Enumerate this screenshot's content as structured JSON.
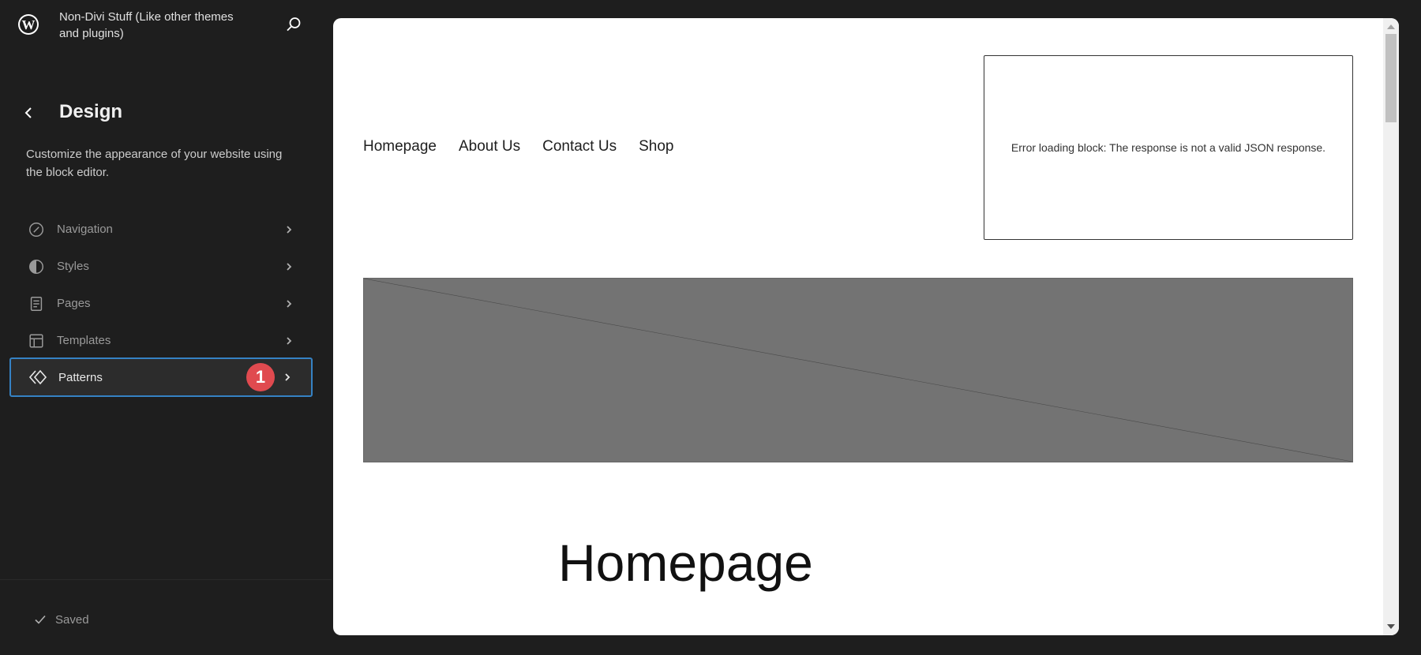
{
  "sidebar": {
    "site_title": "Non-Divi Stuff (Like other themes and plugins)",
    "section_title": "Design",
    "description": "Customize the appearance of your website using the block editor.",
    "items": [
      {
        "label": "Navigation",
        "icon": "navigation-icon"
      },
      {
        "label": "Styles",
        "icon": "styles-icon"
      },
      {
        "label": "Pages",
        "icon": "pages-icon"
      },
      {
        "label": "Templates",
        "icon": "templates-icon"
      },
      {
        "label": "Patterns",
        "icon": "patterns-icon",
        "active": true,
        "badge": "1"
      }
    ],
    "status": "Saved"
  },
  "preview": {
    "nav_links": [
      "Homepage",
      "About Us",
      "Contact Us",
      "Shop"
    ],
    "error_message": "Error loading block: The response is not a valid JSON response.",
    "heading": "Homepage"
  },
  "colors": {
    "accent": "#3582c4",
    "badge": "#e04a4f",
    "placeholder": "#737373"
  }
}
